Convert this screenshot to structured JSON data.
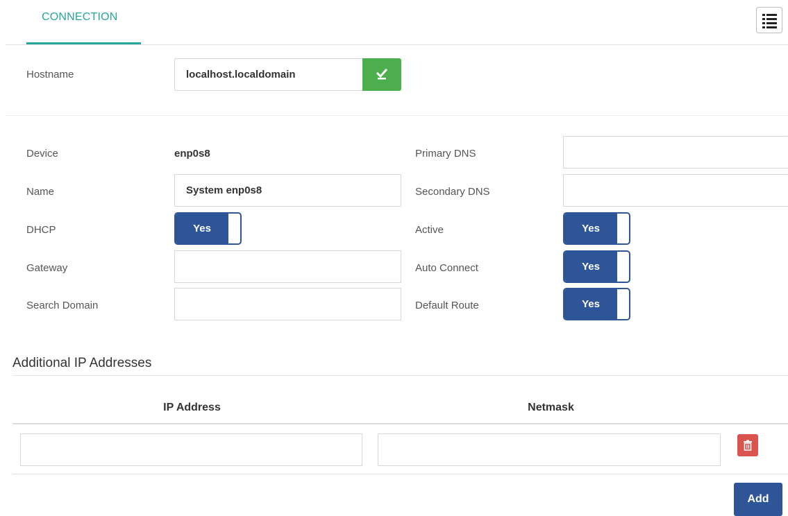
{
  "tabs": [
    {
      "label": "CONNECTION",
      "active": true
    }
  ],
  "toolbar": {
    "menu_icon": "list-icon"
  },
  "hostname": {
    "label": "Hostname",
    "value": "localhost.localdomain",
    "apply_icon": "checkmark-icon",
    "apply_color": "#4cae4c"
  },
  "connection": {
    "device": {
      "label": "Device",
      "value": "enp0s8"
    },
    "name": {
      "label": "Name",
      "value": "System enp0s8"
    },
    "dhcp": {
      "label": "DHCP",
      "value": "Yes"
    },
    "gateway": {
      "label": "Gateway",
      "value": ""
    },
    "search_domain": {
      "label": "Search Domain",
      "value": ""
    },
    "primary_dns": {
      "label": "Primary DNS",
      "value": ""
    },
    "secondary_dns": {
      "label": "Secondary DNS",
      "value": ""
    },
    "active": {
      "label": "Active",
      "value": "Yes"
    },
    "auto_connect": {
      "label": "Auto Connect",
      "value": "Yes"
    },
    "default_route": {
      "label": "Default Route",
      "value": "Yes"
    }
  },
  "additional_ips": {
    "title": "Additional IP Addresses",
    "columns": [
      "IP Address",
      "Netmask"
    ],
    "rows": [
      {
        "ip": "",
        "netmask": "",
        "delete_icon": "trash-icon"
      }
    ],
    "add_label": "Add"
  },
  "colors": {
    "accent": "#26a69a",
    "primary": "#2d5597",
    "success": "#4cae4c",
    "danger": "#d9534f"
  }
}
